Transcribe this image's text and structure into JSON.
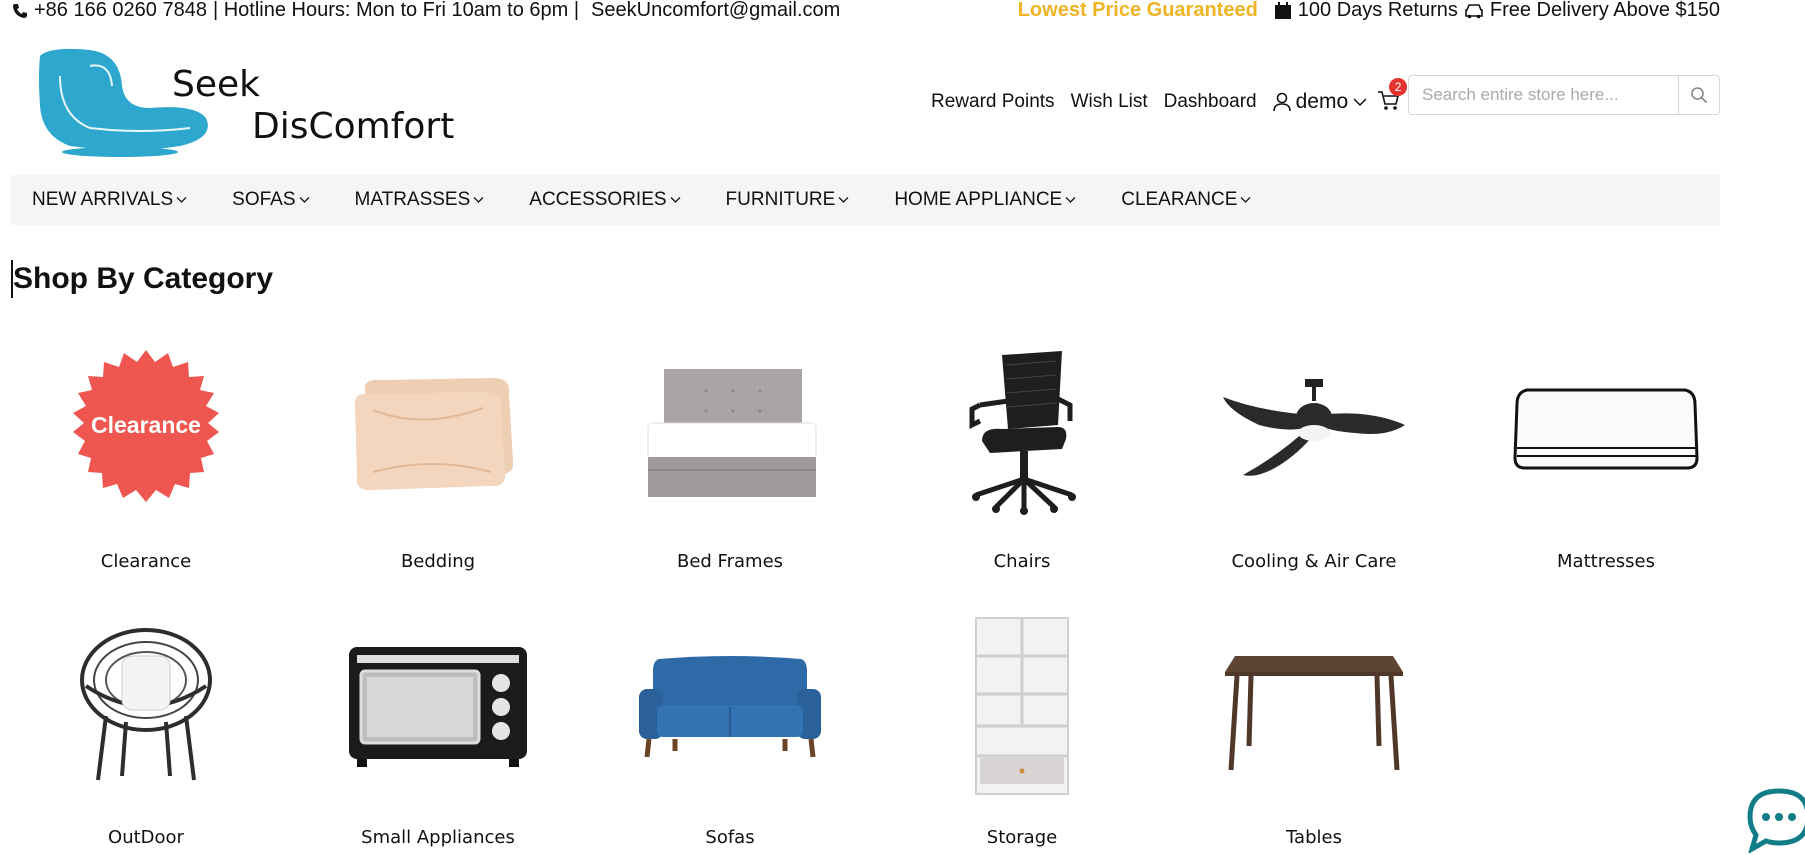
{
  "topbar": {
    "phone": "+86 166 0260 7848",
    "hotline": "| Hotline Hours: Mon to Fri 10am to 6pm |",
    "email": "SeekUncomfort@gmail.com",
    "lowest_price": "Lowest Price Guaranteed",
    "returns": "100 Days Returns",
    "delivery": "Free Delivery Above $150"
  },
  "logo": {
    "line1": "Seek",
    "line2": "DisComfort"
  },
  "header": {
    "links": [
      "Reward Points",
      "Wish List",
      "Dashboard"
    ],
    "user": "demo",
    "cart_count": "2",
    "search_placeholder": "Search entire store here..."
  },
  "nav": [
    "NEW ARRIVALS",
    "SOFAS",
    "MATRASSES",
    "ACCESSORIES",
    "FURNITURE",
    "HOME APPLIANCE",
    "CLEARANCE"
  ],
  "section_title": "Shop By Category",
  "clearance_badge_text": "Clearance",
  "categories": [
    {
      "label": "Clearance",
      "icon": "clearance-badge"
    },
    {
      "label": "Bedding",
      "icon": "pillows"
    },
    {
      "label": "Bed Frames",
      "icon": "bed-frame"
    },
    {
      "label": "Chairs",
      "icon": "office-chair"
    },
    {
      "label": "Cooling & Air Care",
      "icon": "ceiling-fan"
    },
    {
      "label": "Mattresses",
      "icon": "mattress"
    },
    {
      "label": "OutDoor",
      "icon": "outdoor-chair"
    },
    {
      "label": "Small Appliances",
      "icon": "toaster-oven"
    },
    {
      "label": "Sofas",
      "icon": "sofa"
    },
    {
      "label": "Storage",
      "icon": "shelf"
    },
    {
      "label": "Tables",
      "icon": "table"
    }
  ],
  "colors": {
    "accent": "#f0b323",
    "badge": "#e5342e",
    "logo": "#2ea7cf",
    "nav_bg": "#f5f5f5"
  }
}
